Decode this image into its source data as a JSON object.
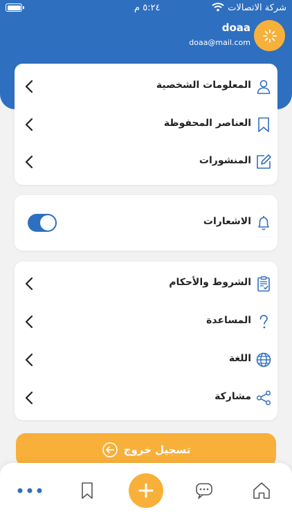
{
  "status_bar": {
    "carrier": "شركة الاتصالات",
    "time": "٥:٢٤ م"
  },
  "profile": {
    "name": "doaa",
    "email": "doaa@mail.com"
  },
  "menu_group_1": [
    {
      "label": "المعلومات الشخصية",
      "icon": "user-icon"
    },
    {
      "label": "العناصر المحفوظة",
      "icon": "bookmark-icon"
    },
    {
      "label": "المنشورات",
      "icon": "edit-icon"
    }
  ],
  "notifications": {
    "label": "الاشعارات",
    "icon": "bell-icon",
    "enabled": true
  },
  "menu_group_3": [
    {
      "label": "الشروط والأحكام",
      "icon": "clipboard-icon"
    },
    {
      "label": "المساعدة",
      "icon": "question-icon"
    },
    {
      "label": "اللغة",
      "icon": "globe-icon"
    },
    {
      "label": "مشاركة",
      "icon": "share-icon"
    }
  ],
  "logout": {
    "label": "تسجيل خروج"
  },
  "tab_bar": {
    "items": [
      "home-icon",
      "chat-icon",
      "add-icon",
      "bookmark-icon",
      "more-icon"
    ]
  },
  "colors": {
    "primary_blue": "#2f6fc0",
    "accent_orange": "#f8b03a",
    "background": "#f2f2f2"
  }
}
